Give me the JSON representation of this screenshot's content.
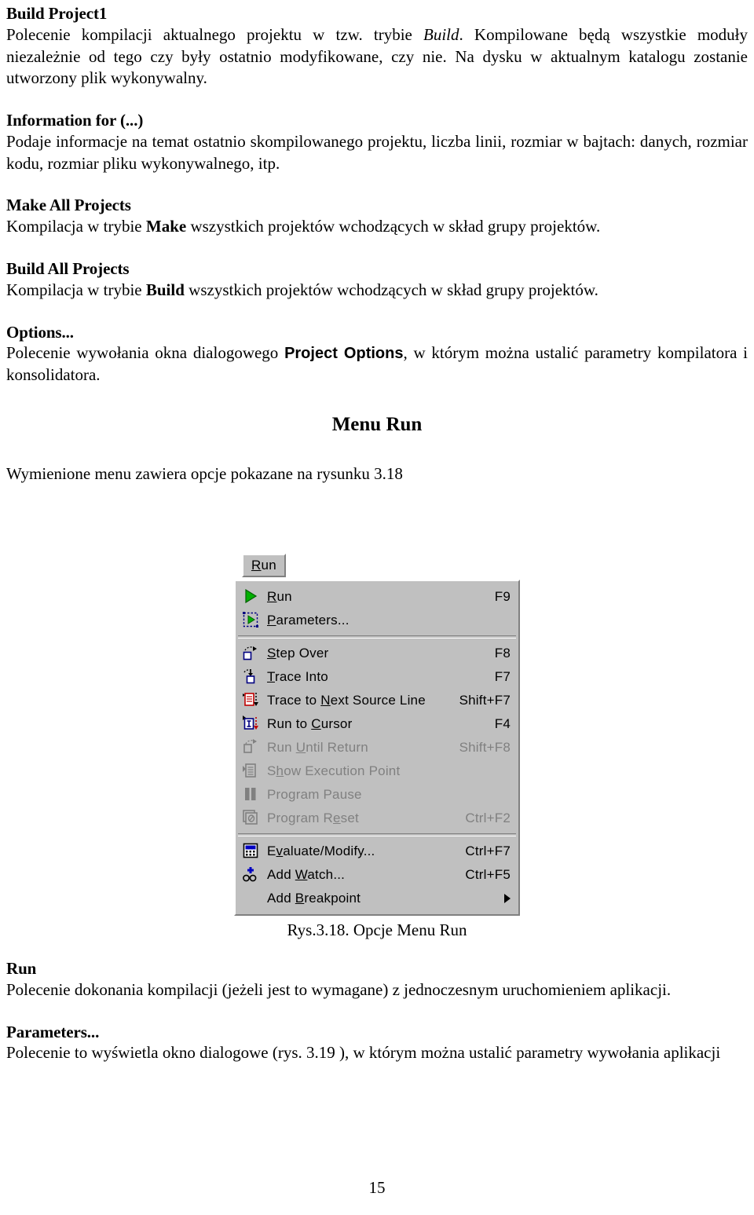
{
  "document": {
    "page_number": "15",
    "sections": [
      {
        "id": "build-project1",
        "heading": "Build Project1",
        "paragraph_parts": [
          {
            "text": "Polecenie kompilacji aktualnego projektu w tzw. trybie ",
            "style": "normal"
          },
          {
            "text": "Build",
            "style": "italic"
          },
          {
            "text": ". Kompilowane będą wszystkie moduły niezależnie od tego czy były ostatnio modyfikowane, czy nie. Na dysku w aktualnym katalogu zostanie utworzony plik wykonywalny.",
            "style": "normal"
          }
        ]
      },
      {
        "id": "information-for",
        "heading": "Information for (...)",
        "paragraph_parts": [
          {
            "text": "Podaje informacje na temat ostatnio skompilowanego projektu, liczba linii, rozmiar w bajtach: danych, rozmiar kodu, rozmiar pliku wykonywalnego, itp.",
            "style": "normal"
          }
        ]
      },
      {
        "id": "make-all-projects",
        "heading": "Make All Projects",
        "paragraph_parts": [
          {
            "text": "Kompilacja w trybie ",
            "style": "normal"
          },
          {
            "text": "Make",
            "style": "bold"
          },
          {
            "text": " wszystkich projektów wchodzących w skład grupy projektów.",
            "style": "normal"
          }
        ]
      },
      {
        "id": "build-all-projects",
        "heading": "Build All Projects",
        "paragraph_parts": [
          {
            "text": "Kompilacja w trybie ",
            "style": "normal"
          },
          {
            "text": "Build",
            "style": "bold"
          },
          {
            "text": " wszystkich projektów wchodzących w skład grupy projektów.",
            "style": "normal"
          }
        ]
      },
      {
        "id": "options",
        "heading": "Options...",
        "paragraph_parts": [
          {
            "text": "Polecenie wywołania okna dialogowego ",
            "style": "normal"
          },
          {
            "text": "Project Options",
            "style": "bold-sans"
          },
          {
            "text": ", w którym można ustalić parametry kompilatora i konsolidatora.",
            "style": "normal"
          }
        ]
      }
    ],
    "menu_run_heading": "Menu Run",
    "menu_intro": "Wymienione menu zawiera opcje pokazane na rysunku 3.18",
    "figure_caption": "Rys.3.18. Opcje Menu Run",
    "sections_after": [
      {
        "id": "run",
        "heading": "Run",
        "paragraph_parts": [
          {
            "text": "Polecenie dokonania kompilacji (jeżeli jest to wymagane) z jednoczesnym uruchomieniem aplikacji.",
            "style": "normal"
          }
        ]
      },
      {
        "id": "parameters",
        "heading": "Parameters...",
        "paragraph_parts": [
          {
            "text": "Polecenie to wyświetla okno dialogowe (rys. 3.19 ), w którym można ustalić parametry wywołania aplikacji",
            "style": "normal"
          }
        ]
      }
    ]
  },
  "menu_screenshot": {
    "tab_label_prefix": "R",
    "tab_label_rest": "un",
    "colors": {
      "face": "#c0c0c0",
      "highlight": "#ffffff",
      "shadow": "#808080",
      "text": "#000000",
      "disabled_text": "#808080",
      "play_green": "#00a000",
      "icon_blue": "#000080",
      "icon_red": "#c00000"
    },
    "items": [
      {
        "icon": "run-play-icon",
        "label_pre": "",
        "label_key": "R",
        "label_post": "un",
        "shortcut": "F9",
        "disabled": false,
        "submenu": false
      },
      {
        "icon": "parameters-icon",
        "label_pre": "",
        "label_key": "P",
        "label_post": "arameters...",
        "shortcut": "",
        "disabled": false,
        "submenu": false
      },
      {
        "separator": true
      },
      {
        "icon": "step-over-icon",
        "label_pre": "",
        "label_key": "S",
        "label_post": "tep Over",
        "shortcut": "F8",
        "disabled": false,
        "submenu": false
      },
      {
        "icon": "trace-into-icon",
        "label_pre": "",
        "label_key": "T",
        "label_post": "race Into",
        "shortcut": "F7",
        "disabled": false,
        "submenu": false
      },
      {
        "icon": "trace-next-source-icon",
        "label_pre": "Trace to ",
        "label_key": "N",
        "label_post": "ext Source Line",
        "shortcut": "Shift+F7",
        "disabled": false,
        "submenu": false
      },
      {
        "icon": "run-to-cursor-icon",
        "label_pre": "Run to ",
        "label_key": "C",
        "label_post": "ursor",
        "shortcut": "F4",
        "disabled": false,
        "submenu": false
      },
      {
        "icon": "run-until-return-icon",
        "label_pre": "Run ",
        "label_key": "U",
        "label_post": "ntil Return",
        "shortcut": "Shift+F8",
        "disabled": true,
        "submenu": false
      },
      {
        "icon": "show-execution-point-icon",
        "label_pre": "S",
        "label_key": "h",
        "label_post": "ow Execution Point",
        "shortcut": "",
        "disabled": true,
        "submenu": false
      },
      {
        "icon": "program-pause-icon",
        "label_pre": "Program Pause",
        "label_key": "",
        "label_post": "",
        "shortcut": "",
        "disabled": true,
        "submenu": false
      },
      {
        "icon": "program-reset-icon",
        "label_pre": "Program R",
        "label_key": "e",
        "label_post": "set",
        "shortcut": "Ctrl+F2",
        "disabled": true,
        "submenu": false
      },
      {
        "separator": true
      },
      {
        "icon": "evaluate-modify-icon",
        "label_pre": "E",
        "label_key": "v",
        "label_post": "aluate/Modify...",
        "shortcut": "Ctrl+F7",
        "disabled": false,
        "submenu": false
      },
      {
        "icon": "add-watch-icon",
        "label_pre": "Add ",
        "label_key": "W",
        "label_post": "atch...",
        "shortcut": "Ctrl+F5",
        "disabled": false,
        "submenu": false
      },
      {
        "icon": "none",
        "label_pre": "Add ",
        "label_key": "B",
        "label_post": "reakpoint",
        "shortcut": "",
        "disabled": false,
        "submenu": true
      }
    ]
  }
}
